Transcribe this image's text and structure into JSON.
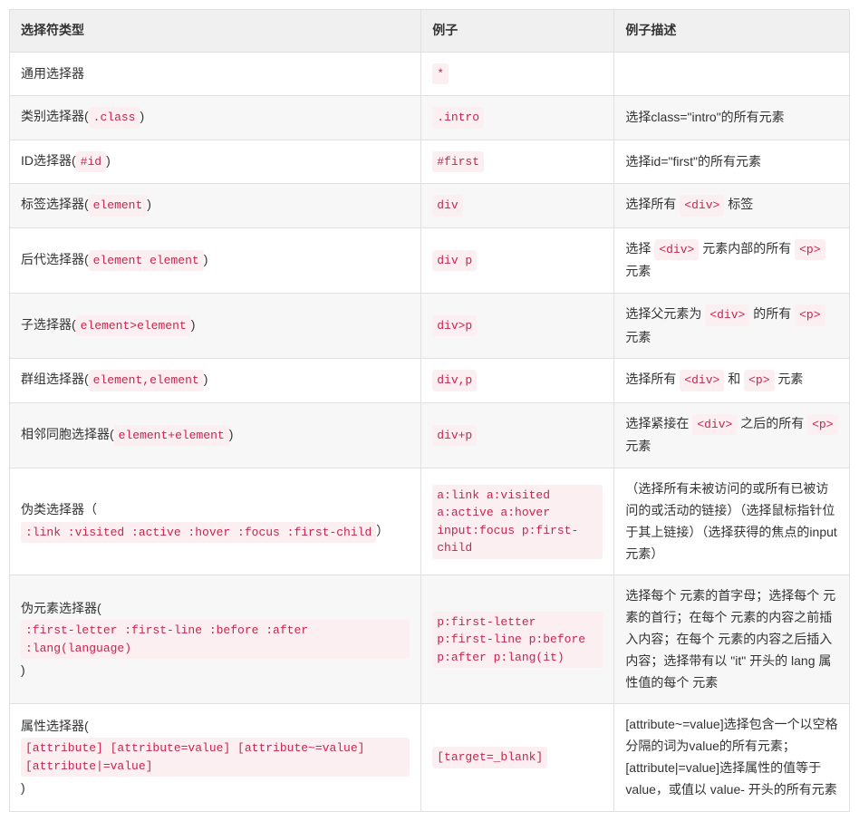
{
  "headers": {
    "type": "选择符类型",
    "example": "例子",
    "desc": "例子描述"
  },
  "rows": [
    {
      "type_plain": "通用选择器",
      "type_code": "",
      "example_codes": [
        "*"
      ],
      "desc_pre": "",
      "desc_codes": [],
      "desc_post": ""
    },
    {
      "type_plain": "类别选择器(",
      "type_code": ".class",
      "type_suffix": ")",
      "example_codes": [
        ".intro"
      ],
      "desc_plain": "选择class=\"intro\"的所有元素"
    },
    {
      "type_plain": "ID选择器(",
      "type_code": "#id",
      "type_suffix": ")",
      "example_codes": [
        "#first"
      ],
      "desc_plain": "选择id=\"first\"的所有元素"
    },
    {
      "type_plain": "标签选择器(",
      "type_code": "element",
      "type_suffix": ")",
      "example_codes": [
        "div"
      ],
      "desc_segments": [
        {
          "text": "选择所有 "
        },
        {
          "code": "<div>"
        },
        {
          "text": " 标签"
        }
      ]
    },
    {
      "type_plain": "后代选择器(",
      "type_code": "element element",
      "type_suffix": ")",
      "example_codes": [
        "div p"
      ],
      "desc_segments": [
        {
          "text": "选择 "
        },
        {
          "code": "<div>"
        },
        {
          "text": " 元素内部的所有 "
        },
        {
          "code": "<p>"
        },
        {
          "text": " 元素"
        }
      ]
    },
    {
      "type_plain": "子选择器(",
      "type_code": "element>element",
      "type_suffix": ")",
      "example_codes": [
        "div>p"
      ],
      "desc_segments": [
        {
          "text": "选择父元素为 "
        },
        {
          "code": "<div>"
        },
        {
          "text": " 的所有 "
        },
        {
          "code": "<p>"
        },
        {
          "text": " 元素"
        }
      ]
    },
    {
      "type_plain": "群组选择器(",
      "type_code": "element,element",
      "type_suffix": ")",
      "example_codes": [
        "div,p"
      ],
      "desc_segments": [
        {
          "text": "选择所有 "
        },
        {
          "code": "<div>"
        },
        {
          "text": " 和 "
        },
        {
          "code": "<p>"
        },
        {
          "text": " 元素"
        }
      ]
    },
    {
      "type_plain": "相邻同胞选择器(",
      "type_code": "element+element",
      "type_suffix": ")",
      "example_codes": [
        "div+p"
      ],
      "desc_segments": [
        {
          "text": "选择紧接在 "
        },
        {
          "code": "<div>"
        },
        {
          "text": " 之后的所有 "
        },
        {
          "code": "<p>"
        },
        {
          "text": " 元素"
        }
      ]
    },
    {
      "type_segments": [
        {
          "text": "伪类选择器（"
        },
        {
          "code": ":link :visited :active :hover :focus :first-child"
        },
        {
          "text": "）"
        }
      ],
      "example_codes": [
        "a:link a:visited a:active a:hover input:focus p:first-child"
      ],
      "desc_plain": "（选择所有未被访问的或所有已被访问的或活动的链接）（选择鼠标指针位于其上链接）（选择获得的焦点的input 元素）"
    },
    {
      "type_segments": [
        {
          "text": "伪元素选择器("
        },
        {
          "code": ":first-letter :first-line :before :after :lang(language)"
        },
        {
          "text": ")"
        }
      ],
      "example_codes": [
        "p:first-letter p:first-line p:before p:after p:lang(it)"
      ],
      "desc_plain": "选择每个 元素的首字母；选择每个 元素的首行；在每个 元素的内容之前插入内容；在每个 元素的内容之后插入内容；选择带有以 \"it\" 开头的 lang 属性值的每个 元素"
    },
    {
      "type_segments": [
        {
          "text": "属性选择器("
        },
        {
          "code": "[attribute] [attribute=value] [attribute~=value] [attribute|=value]"
        },
        {
          "text": " )"
        }
      ],
      "example_codes": [
        "[target=_blank]"
      ],
      "desc_plain": "[attribute~=value]选择包含一个以空格分隔的词为value的所有元素；[attribute|=value]选择属性的值等于value，或值以 value- 开头的所有元素"
    }
  ]
}
